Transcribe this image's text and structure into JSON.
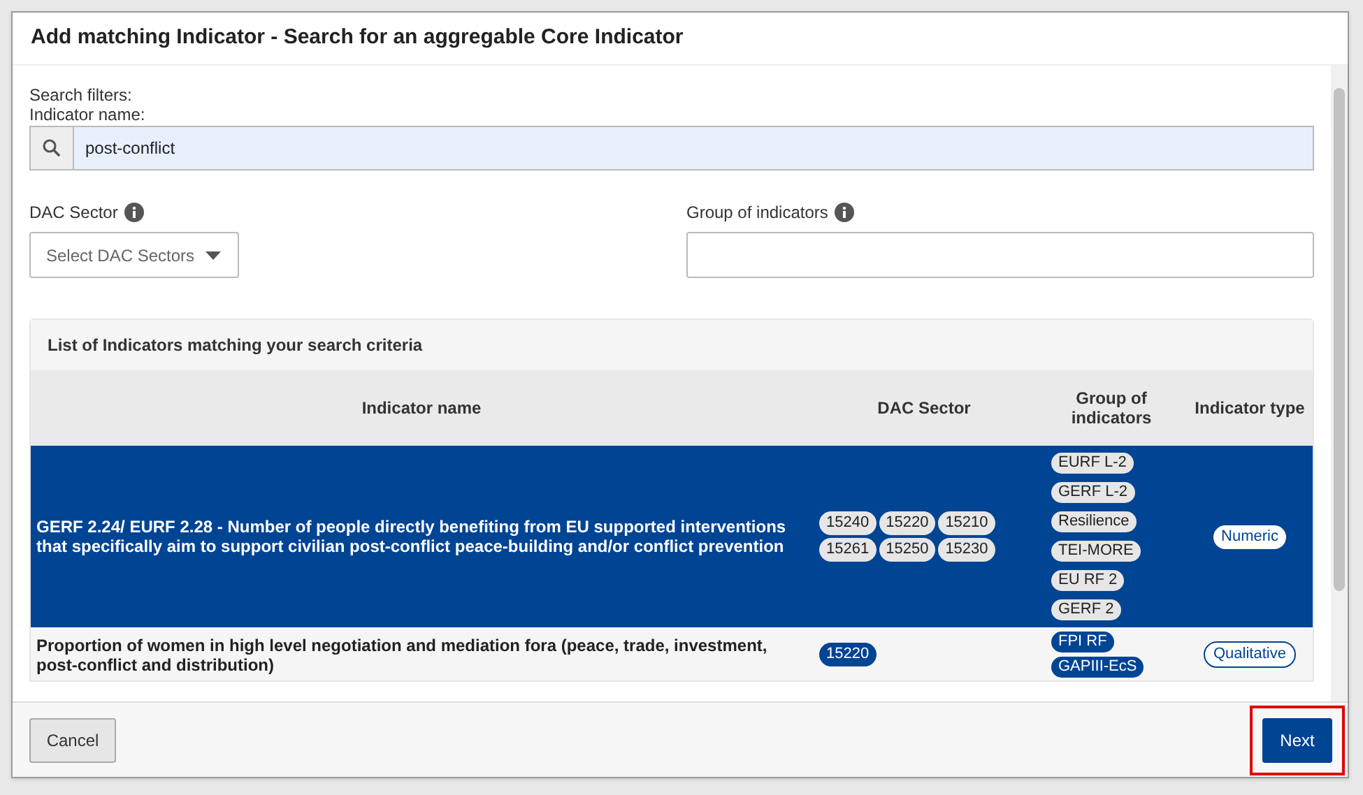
{
  "dialog": {
    "title": "Add matching Indicator - Search for an aggregable Core Indicator"
  },
  "filters": {
    "heading": "Search filters:",
    "name_label": "Indicator name:",
    "name_value": "post-conflict",
    "dac_label": "DAC Sector",
    "dac_placeholder": "Select DAC Sectors",
    "group_label": "Group of indicators"
  },
  "results": {
    "heading": "List of Indicators matching your search criteria",
    "columns": [
      "Indicator name",
      "DAC Sector",
      "Group of indicators",
      "Indicator type"
    ],
    "rows": [
      {
        "selected": true,
        "name": "GERF 2.24/ EURF 2.28 - Number of people directly benefiting from EU supported interventions that specifically aim to support civilian post-conflict peace-building and/or conflict prevention",
        "dac": [
          "15240",
          "15220",
          "15210",
          "15261",
          "15250",
          "15230"
        ],
        "groups": [
          "EURF L-2",
          "GERF L-2",
          "Resilience",
          "TEI-MORE",
          "EU RF 2",
          "GERF 2"
        ],
        "type": "Numeric"
      },
      {
        "selected": false,
        "name": "Proportion of women in high level negotiation and mediation fora (peace, trade, investment, post-conflict and distribution)",
        "dac": [
          "15220"
        ],
        "groups": [
          "FPI RF",
          "GAPIII-EcS"
        ],
        "type": "Qualitative"
      }
    ]
  },
  "buttons": {
    "cancel": "Cancel",
    "next": "Next"
  }
}
